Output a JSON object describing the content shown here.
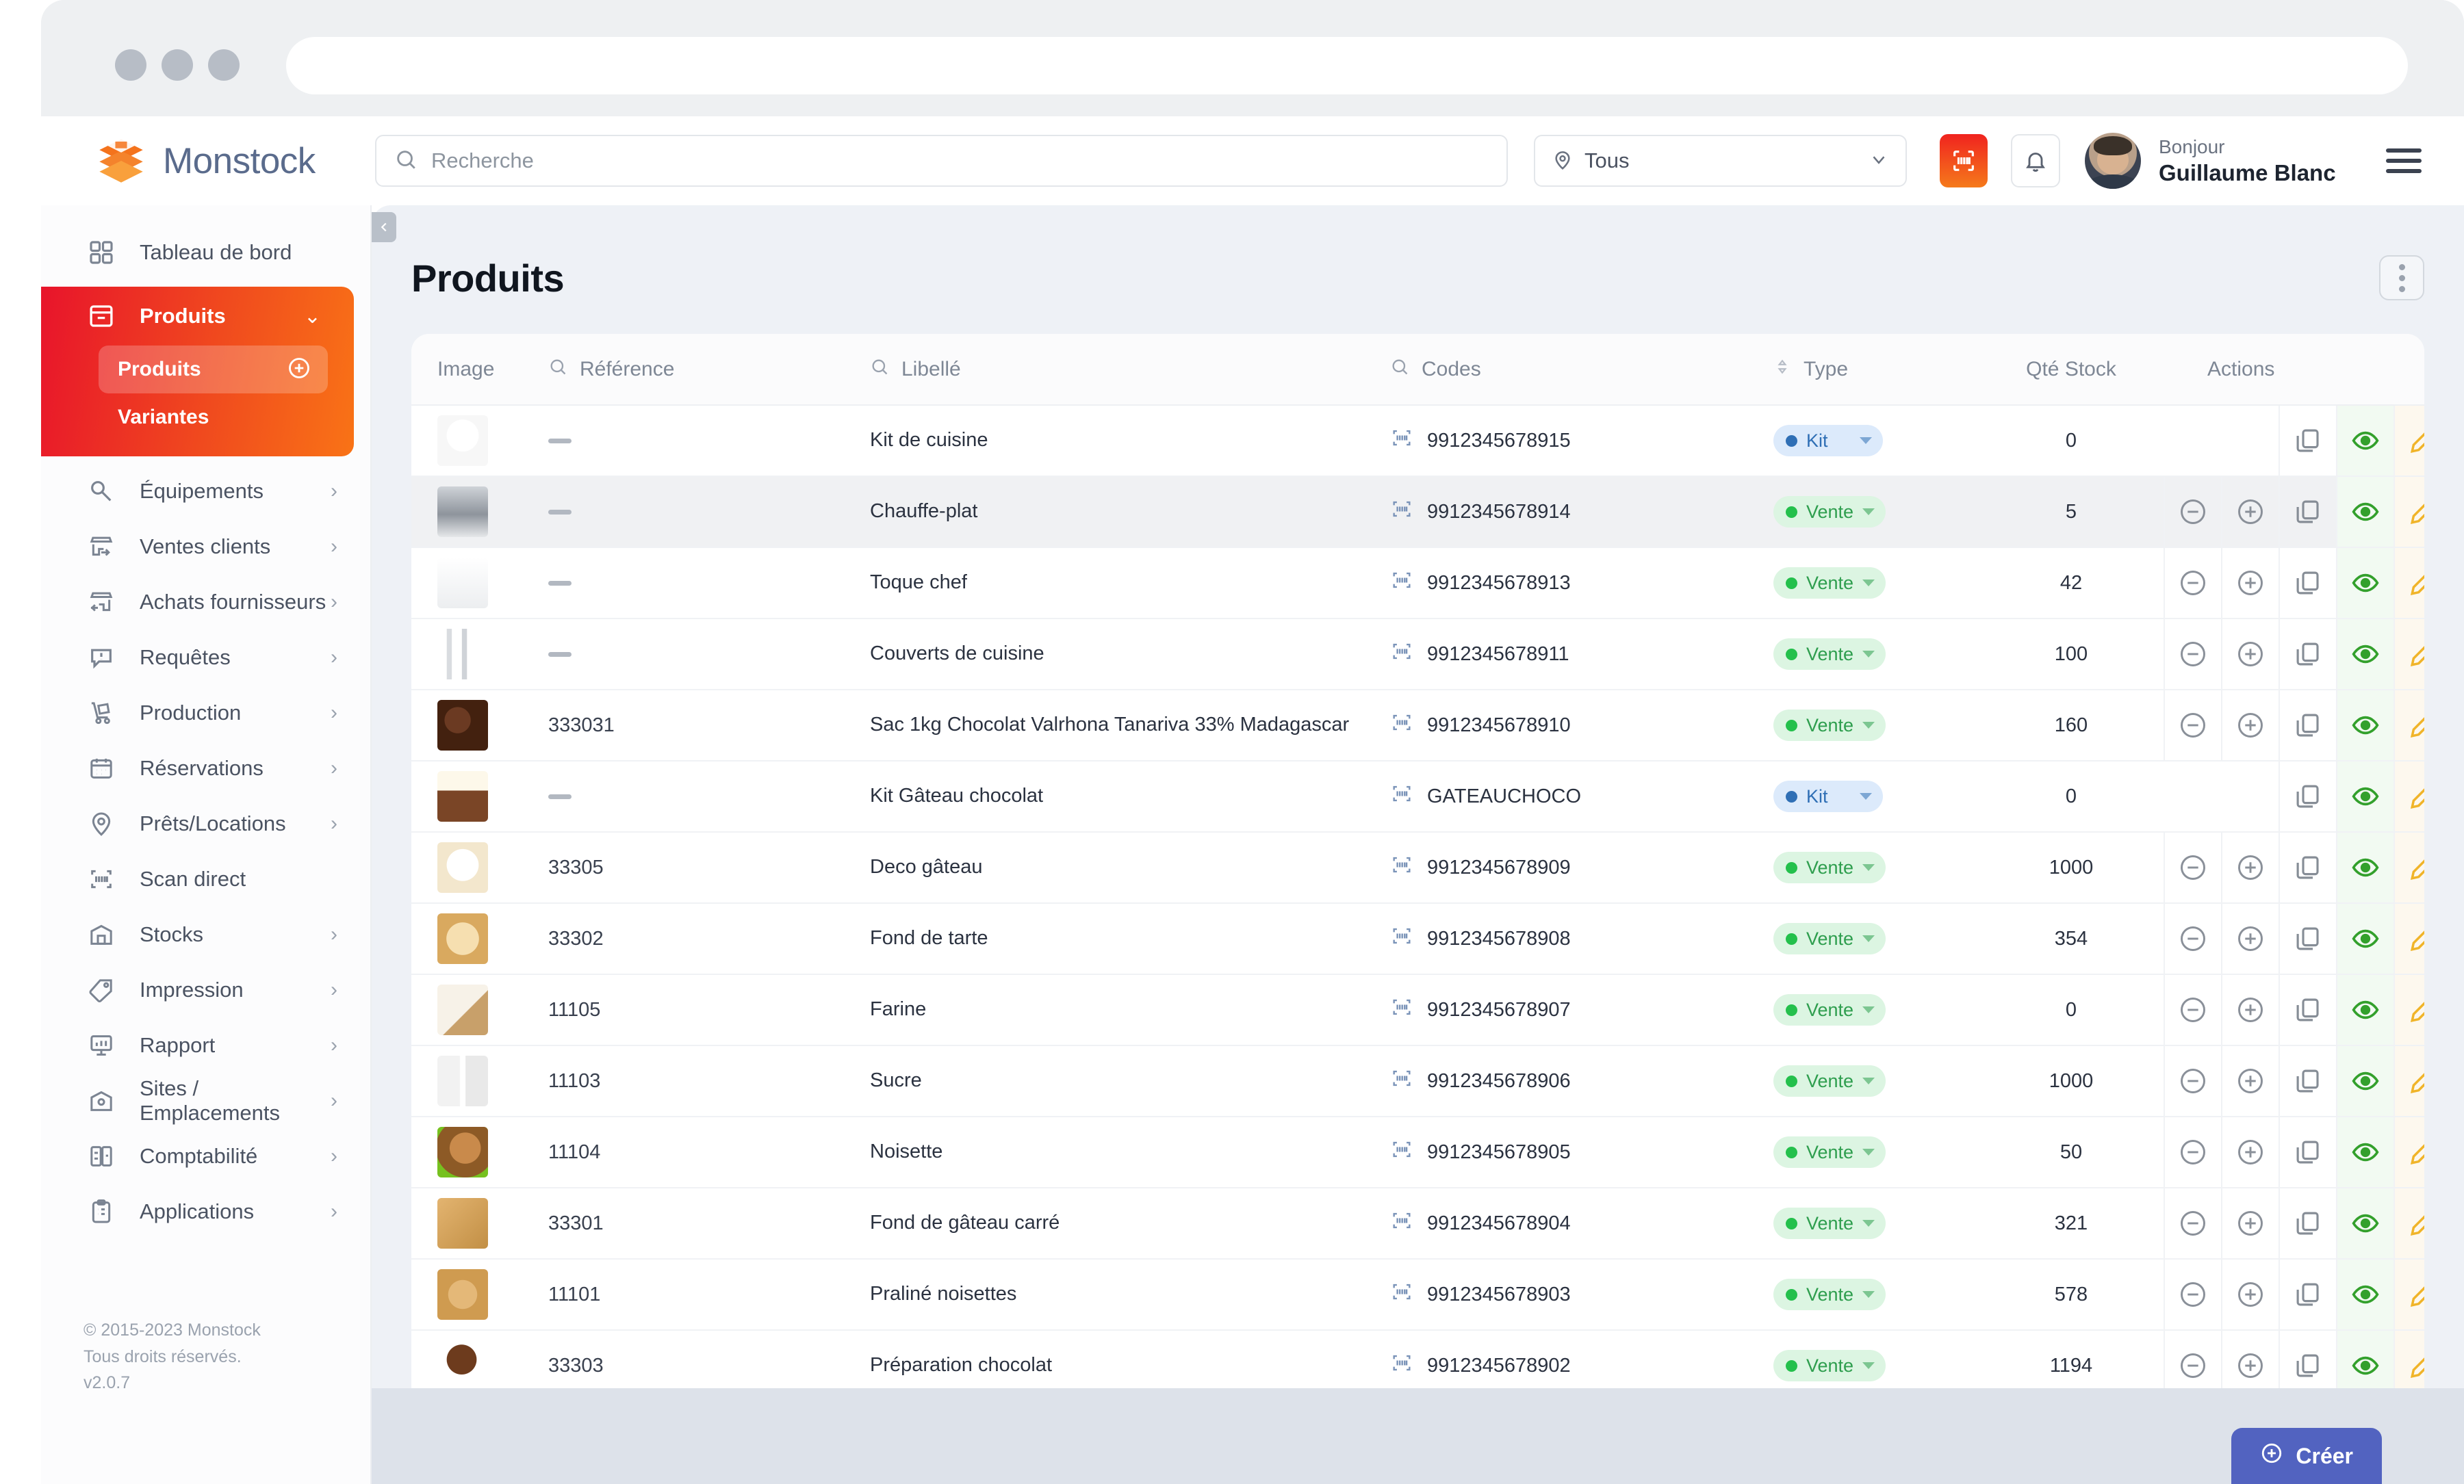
{
  "browser": {
    "dots": [
      "close",
      "minimize",
      "maximize"
    ],
    "url_value": ""
  },
  "header": {
    "brand": "Monstock",
    "search": {
      "placeholder": "Recherche",
      "value": ""
    },
    "site_filter": {
      "value": "Tous"
    },
    "scan_label": "scan-barcode",
    "notifications_label": "notifications",
    "greeting_small": "Bonjour",
    "user_name": "Guillaume Blanc",
    "menu_label": "menu"
  },
  "sidebar": {
    "items": [
      {
        "label": "Tableau de bord",
        "icon": "dashboard-grid-icon",
        "chevron": ""
      },
      {
        "label": "Équipements",
        "icon": "wrench-icon",
        "chevron": "›"
      },
      {
        "label": "Ventes clients",
        "icon": "store-out-icon",
        "chevron": "›"
      },
      {
        "label": "Achats fournisseurs",
        "icon": "store-in-icon",
        "chevron": "›"
      },
      {
        "label": "Requêtes",
        "icon": "alert-bubble-icon",
        "chevron": "›"
      },
      {
        "label": "Production",
        "icon": "hand-truck-icon",
        "chevron": "›"
      },
      {
        "label": "Réservations",
        "icon": "calendar-icon",
        "chevron": "›"
      },
      {
        "label": "Prêts/Locations",
        "icon": "pin-icon",
        "chevron": "›"
      },
      {
        "label": "Scan direct",
        "icon": "barcode-scan-icon",
        "chevron": ""
      },
      {
        "label": "Stocks",
        "icon": "warehouse-icon",
        "chevron": "›"
      },
      {
        "label": "Impression",
        "icon": "tag-icon",
        "chevron": "›"
      },
      {
        "label": "Rapport",
        "icon": "report-board-icon",
        "chevron": "›"
      },
      {
        "label": "Sites / Emplacements",
        "icon": "site-pin-icon",
        "chevron": "›"
      },
      {
        "label": "Comptabilité",
        "icon": "ledger-icon",
        "chevron": "›"
      },
      {
        "label": "Applications",
        "icon": "clipboard-icon",
        "chevron": "›"
      }
    ],
    "active_group": {
      "label": "Produits",
      "icon": "box-icon",
      "chevron": "⌄",
      "children": [
        {
          "label": "Produits",
          "active": true,
          "add_icon": "plus-circle-icon"
        },
        {
          "label": "Variantes",
          "active": false
        }
      ]
    },
    "footer": {
      "copyright": "© 2015-2023 Monstock",
      "rights": "Tous droits réservés.",
      "version": "v2.0.7"
    },
    "collapse_icon": "collapse-left-icon"
  },
  "main": {
    "title": "Produits",
    "overflow_menu_label": "more-options",
    "create_button": "Créer",
    "table": {
      "headers": [
        {
          "label": "Image",
          "search": false,
          "sort": false
        },
        {
          "label": "Référence",
          "search": true,
          "sort": false
        },
        {
          "label": "Libellé",
          "search": true,
          "sort": false
        },
        {
          "label": "Codes",
          "search": true,
          "sort": false
        },
        {
          "label": "Type",
          "search": false,
          "sort": true
        },
        {
          "label": "Qté Stock",
          "search": false,
          "sort": false
        },
        {
          "label": "Actions",
          "search": false,
          "sort": false
        }
      ],
      "rows": [
        {
          "image": "chef-cuisine-logo",
          "reference": "—",
          "libelle": "Kit de cuisine",
          "code": "9912345678915",
          "type": "Kit",
          "qty": "0",
          "stepper": false,
          "highlight": false
        },
        {
          "image": "chafing-dish-photo",
          "reference": "—",
          "libelle": "Chauffe-plat",
          "code": "9912345678914",
          "type": "Vente",
          "qty": "5",
          "stepper": true,
          "highlight": true
        },
        {
          "image": "chef-hat-photo",
          "reference": "—",
          "libelle": "Toque chef",
          "code": "9912345678913",
          "type": "Vente",
          "qty": "42",
          "stepper": true,
          "highlight": false
        },
        {
          "image": "cutlery-photo",
          "reference": "—",
          "libelle": "Couverts de cuisine",
          "code": "9912345678911",
          "type": "Vente",
          "qty": "100",
          "stepper": true,
          "highlight": false
        },
        {
          "image": "chocolate-beans-photo",
          "reference": "333031",
          "libelle": "Sac 1kg Chocolat Valrhona Tanariva 33% Madagascar",
          "code": "9912345678910",
          "type": "Vente",
          "qty": "160",
          "stepper": true,
          "highlight": false
        },
        {
          "image": "chocolate-cake-kit-photo",
          "reference": "—",
          "libelle": "Kit Gâteau chocolat",
          "code": "GATEAUCHOCO",
          "type": "Kit",
          "qty": "0",
          "stepper": false,
          "highlight": false
        },
        {
          "image": "cake-deco-photo",
          "reference": "33305",
          "libelle": "Deco gâteau",
          "code": "9912345678909",
          "type": "Vente",
          "qty": "1000",
          "stepper": true,
          "highlight": false
        },
        {
          "image": "tart-base-photo",
          "reference": "33302",
          "libelle": "Fond de tarte",
          "code": "9912345678908",
          "type": "Vente",
          "qty": "354",
          "stepper": true,
          "highlight": false
        },
        {
          "image": "flour-photo",
          "reference": "11105",
          "libelle": "Farine",
          "code": "9912345678907",
          "type": "Vente",
          "qty": "0",
          "stepper": true,
          "highlight": false
        },
        {
          "image": "sugar-cubes-photo",
          "reference": "11103",
          "libelle": "Sucre",
          "code": "9912345678906",
          "type": "Vente",
          "qty": "1000",
          "stepper": true,
          "highlight": false
        },
        {
          "image": "hazelnut-photo",
          "reference": "11104",
          "libelle": "Noisette",
          "code": "9912345678905",
          "type": "Vente",
          "qty": "50",
          "stepper": true,
          "highlight": false
        },
        {
          "image": "square-cake-base-photo",
          "reference": "33301",
          "libelle": "Fond de gâteau carré",
          "code": "9912345678904",
          "type": "Vente",
          "qty": "321",
          "stepper": true,
          "highlight": false
        },
        {
          "image": "praline-photo",
          "reference": "11101",
          "libelle": "Praliné noisettes",
          "code": "9912345678903",
          "type": "Vente",
          "qty": "578",
          "stepper": true,
          "highlight": false
        },
        {
          "image": "chocolate-prep-photo",
          "reference": "33303",
          "libelle": "Préparation chocolat",
          "code": "9912345678902",
          "type": "Vente",
          "qty": "1194",
          "stepper": true,
          "highlight": false
        }
      ],
      "action_icons": [
        "minus-circle-icon",
        "plus-circle-icon",
        "duplicate-icon",
        "eye-icon",
        "pencil-icon",
        "trash-icon"
      ]
    }
  },
  "colors": {
    "brand_orange": "#f4731c",
    "brand_red": "#e8142b",
    "brand_blue": "#5a6b8c",
    "accent_green": "#24c04c",
    "accent_kit_blue": "#2f6fb5",
    "create_purple": "#5263c0"
  }
}
